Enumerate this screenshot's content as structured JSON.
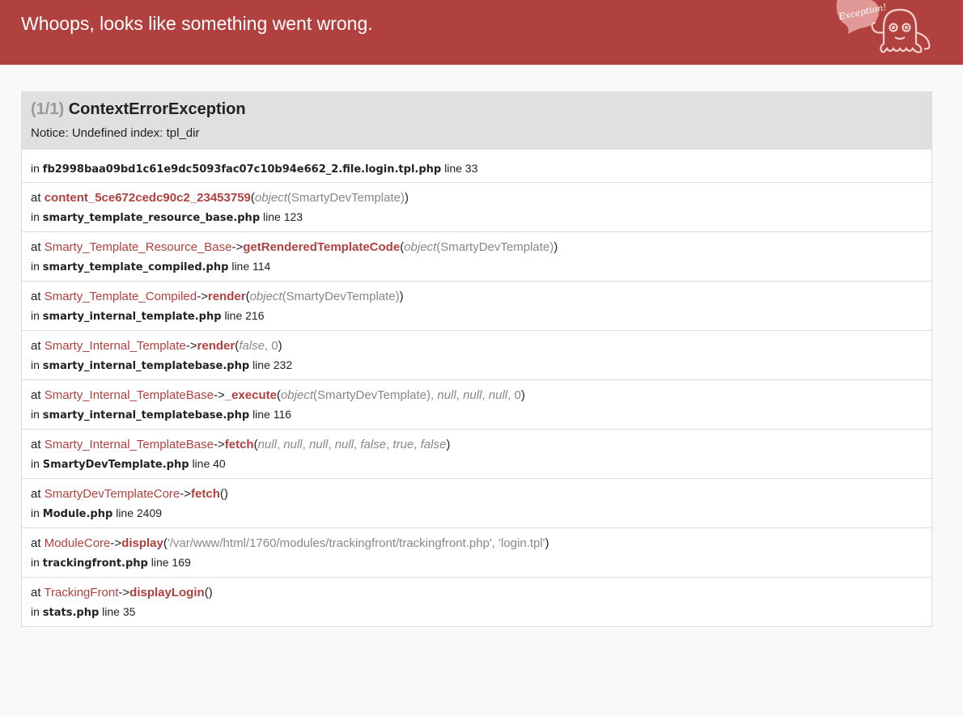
{
  "header": {
    "title": "Whoops, looks like something went wrong.",
    "mascot_label": "Exception!"
  },
  "exception": {
    "count": "(1/1)",
    "name": "ContextErrorException",
    "message": "Notice: Undefined index: tpl_dir"
  },
  "trace_first": {
    "in_label": "in",
    "file": "fb2998baa09bd1c61e9dc5093fac07c10b94e662_2.file.login.tpl.php",
    "line_label": "line 33"
  },
  "trace": [
    {
      "at": "at",
      "cls": "",
      "arrow": "",
      "fn": "content_5ce672cedc90c2_23453759",
      "open": "(",
      "args_html": "<span class='it'>object</span>(SmartyDevTemplate)",
      "close": ")",
      "in": "in",
      "file": "smarty_template_resource_base.php",
      "line": "line 123"
    },
    {
      "at": "at",
      "cls": "Smarty_Template_Resource_Base",
      "arrow": "->",
      "fn": "getRenderedTemplateCode",
      "open": "(",
      "args_html": "<span class='it'>object</span>(SmartyDevTemplate)",
      "close": ")",
      "in": "in",
      "file": "smarty_template_compiled.php",
      "line": "line 114"
    },
    {
      "at": "at",
      "cls": "Smarty_Template_Compiled",
      "arrow": "->",
      "fn": "render",
      "open": "(",
      "args_html": "<span class='it'>object</span>(SmartyDevTemplate)",
      "close": ")",
      "in": "in",
      "file": "smarty_internal_template.php",
      "line": "line 216"
    },
    {
      "at": "at",
      "cls": "Smarty_Internal_Template",
      "arrow": "->",
      "fn": "render",
      "open": "(",
      "args_html": "<span class='it'>false</span>, 0",
      "close": ")",
      "in": "in",
      "file": "smarty_internal_templatebase.php",
      "line": "line 232"
    },
    {
      "at": "at",
      "cls": "Smarty_Internal_TemplateBase",
      "arrow": "->",
      "fn": "_execute",
      "open": "(",
      "args_html": "<span class='it'>object</span>(SmartyDevTemplate), <span class='it'>null</span>, <span class='it'>null</span>, <span class='it'>null</span>, 0",
      "close": ")",
      "in": "in",
      "file": "smarty_internal_templatebase.php",
      "line": "line 116"
    },
    {
      "at": "at",
      "cls": "Smarty_Internal_TemplateBase",
      "arrow": "->",
      "fn": "fetch",
      "open": "(",
      "args_html": "<span class='it'>null</span>, <span class='it'>null</span>, <span class='it'>null</span>, <span class='it'>null</span>, <span class='it'>false</span>, <span class='it'>true</span>, <span class='it'>false</span>",
      "close": ")",
      "in": "in",
      "file": "SmartyDevTemplate.php",
      "line": "line 40"
    },
    {
      "at": "at",
      "cls": "SmartyDevTemplateCore",
      "arrow": "->",
      "fn": "fetch",
      "open": "(",
      "args_html": "",
      "close": ")",
      "in": "in",
      "file": "Module.php",
      "line": "line 2409"
    },
    {
      "at": "at",
      "cls": "ModuleCore",
      "arrow": "->",
      "fn": "display",
      "open": "(",
      "args_html": "'/var/www/html/1760/modules/trackingfront/trackingfront.php', 'login.tpl'",
      "close": ")",
      "in": "in",
      "file": "trackingfront.php",
      "line": "line 169"
    },
    {
      "at": "at",
      "cls": "TrackingFront",
      "arrow": "->",
      "fn": "displayLogin",
      "open": "(",
      "args_html": "",
      "close": ")",
      "in": "in",
      "file": "stats.php",
      "line": "line 35"
    }
  ]
}
